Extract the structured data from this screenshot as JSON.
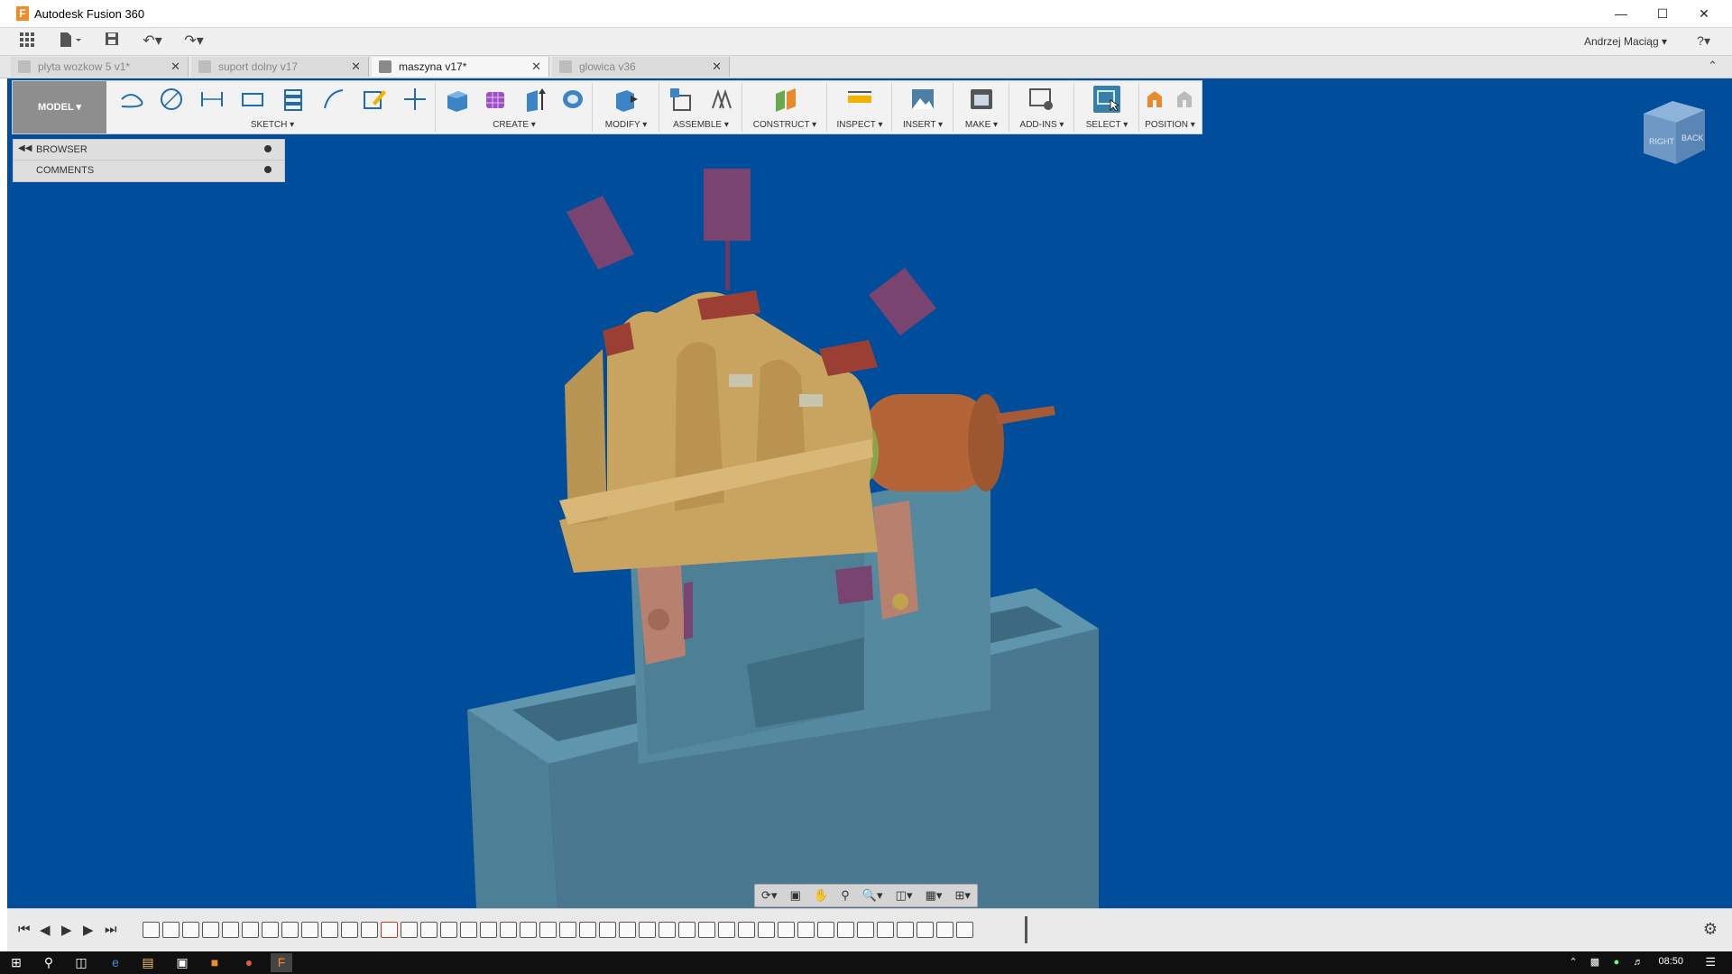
{
  "window": {
    "title": "Autodesk Fusion 360",
    "logo_letter": "F"
  },
  "quick_toolbar": {
    "user": "Andrzej Maciąg ▾",
    "help": "?▾"
  },
  "tabs": [
    {
      "label": "plyta wozkow 5 v1*",
      "close": "✕"
    },
    {
      "label": "suport dolny v17",
      "close": "✕"
    },
    {
      "label": "maszyna v17*",
      "close": "✕"
    },
    {
      "label": "glowica v36",
      "close": "✕"
    }
  ],
  "toolbar": {
    "workspace": "MODEL ▾",
    "groups": [
      {
        "label": "SKETCH ▾"
      },
      {
        "label": "CREATE ▾"
      },
      {
        "label": "MODIFY ▾"
      },
      {
        "label": "ASSEMBLE ▾"
      },
      {
        "label": "CONSTRUCT ▾"
      },
      {
        "label": "INSPECT ▾"
      },
      {
        "label": "INSERT ▾"
      },
      {
        "label": "MAKE ▾"
      },
      {
        "label": "ADD-INS ▾"
      },
      {
        "label": "SELECT ▾"
      },
      {
        "label": "POSITION ▾"
      }
    ]
  },
  "browser_panel": {
    "rows": [
      {
        "label": "BROWSER"
      },
      {
        "label": "COMMENTS"
      }
    ]
  },
  "viewcube": {
    "right": "RIGHT",
    "back": "BACK"
  },
  "taskbar": {
    "time": "08:50"
  },
  "colors": {
    "viewport_bg": "#004d9c",
    "part_wood": "#c9a461",
    "part_purple": "#7a4470",
    "part_base": "#4e7f96",
    "part_copper": "#b36538",
    "part_red": "#9b3f35",
    "select_active": "#3a7fa8"
  }
}
